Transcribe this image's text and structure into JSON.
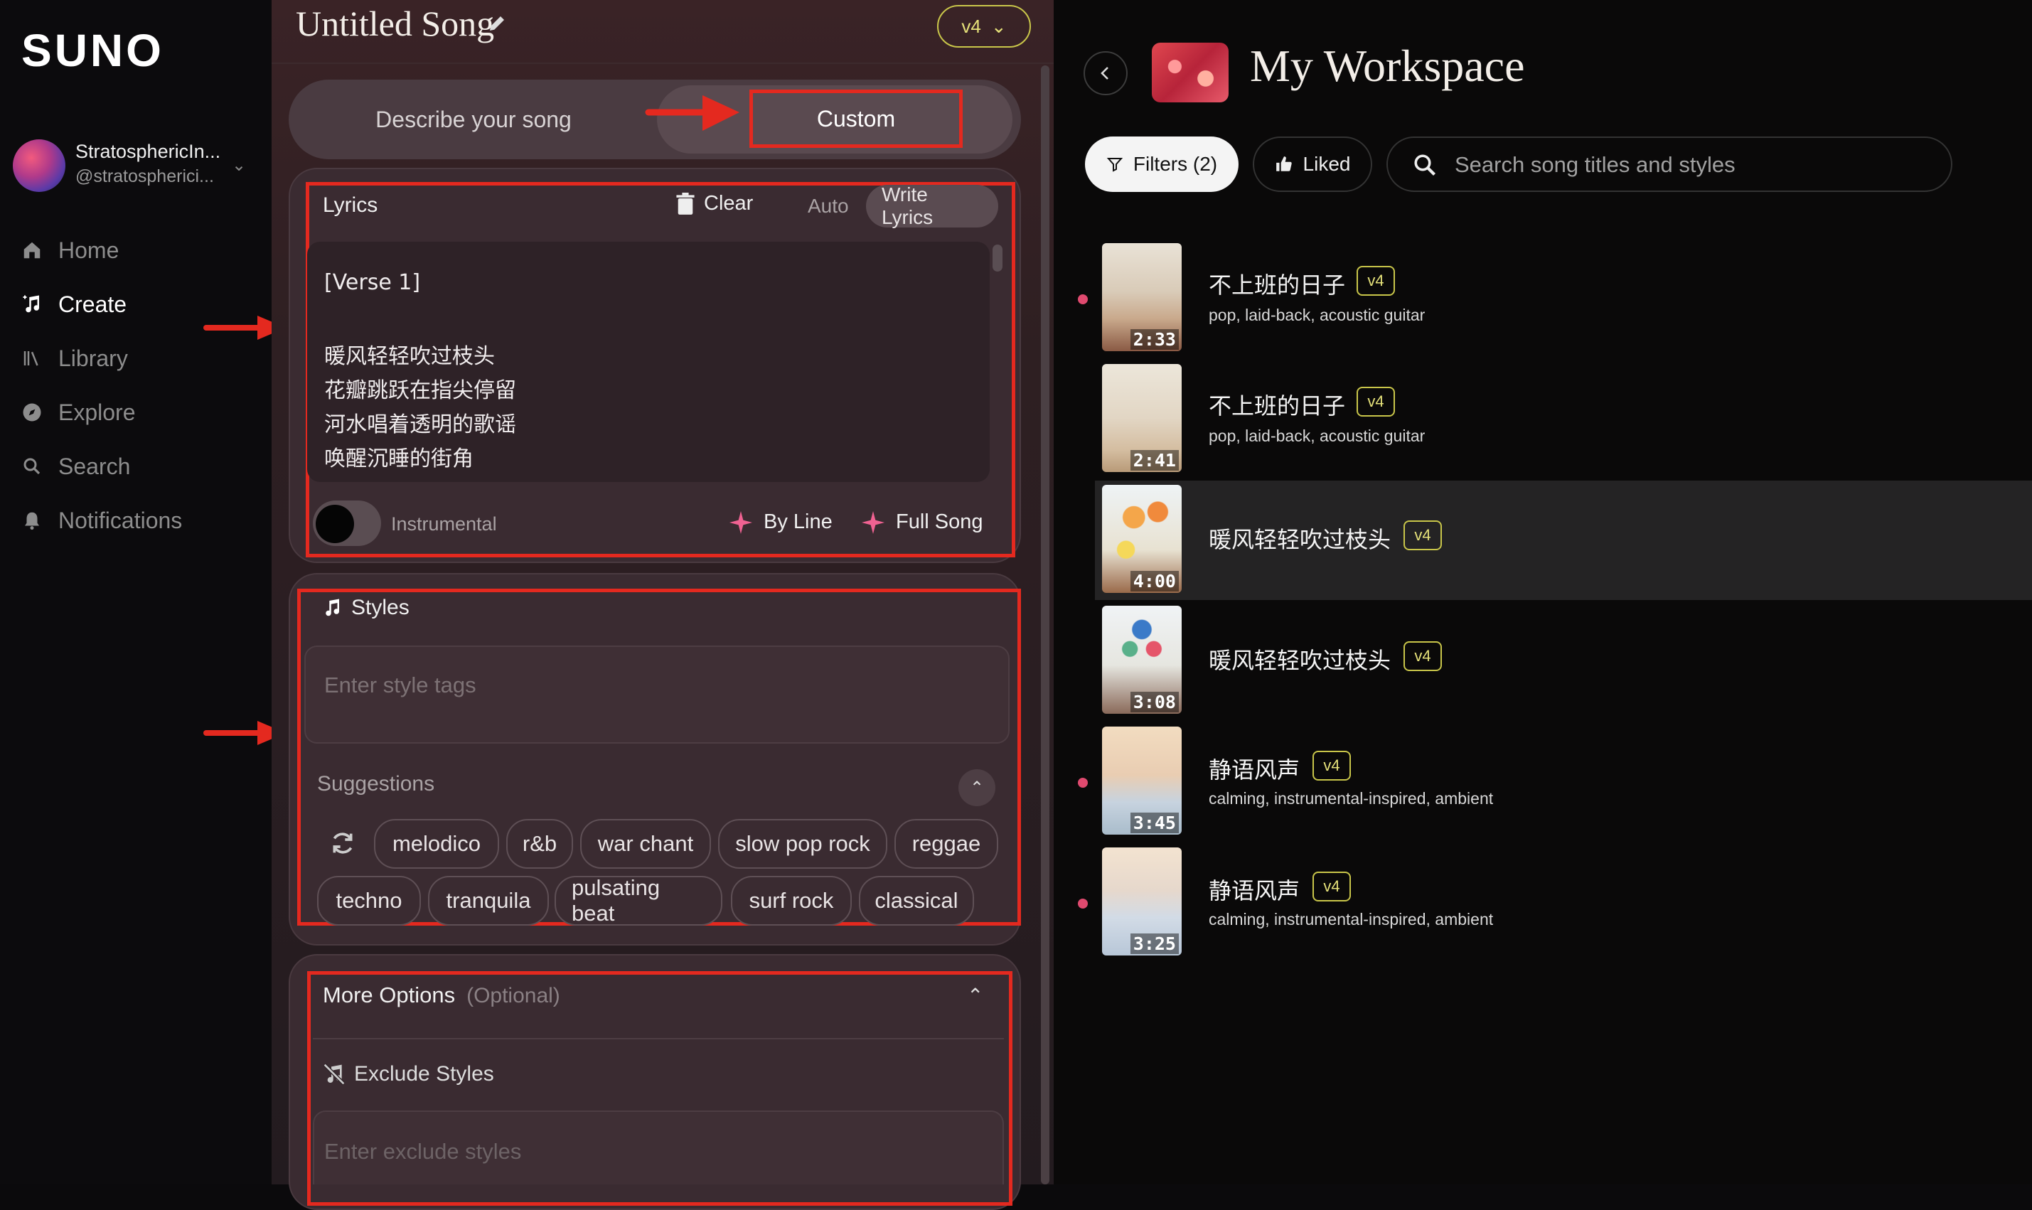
{
  "sidebar": {
    "logo": "SUNO",
    "account_name": "StratosphericIn...",
    "account_handle": "@stratospherici...",
    "nav": [
      {
        "label": "Home",
        "icon": "home-icon"
      },
      {
        "label": "Create",
        "icon": "music-note-icon"
      },
      {
        "label": "Library",
        "icon": "library-icon"
      },
      {
        "label": "Explore",
        "icon": "compass-icon"
      },
      {
        "label": "Search",
        "icon": "search-icon"
      },
      {
        "label": "Notifications",
        "icon": "bell-icon"
      }
    ],
    "active": "Create"
  },
  "create": {
    "title": "Untitled Song",
    "version": "v4",
    "mode_describe": "Describe your song",
    "mode_custom": "Custom",
    "lyrics": {
      "label": "Lyrics",
      "clear": "Clear",
      "auto": "Auto",
      "write": "Write Lyrics",
      "lines": [
        "[Verse 1]",
        "",
        "暖风轻轻吹过枝头",
        "花瓣跳跃在指尖停留",
        "河水唱着透明的歌谣",
        "唤醒沉睡的街角"
      ],
      "instrumental": "Instrumental",
      "by_line": "By Line",
      "full_song": "Full Song"
    },
    "styles": {
      "label": "Styles",
      "placeholder": "Enter style tags",
      "suggestions_label": "Suggestions",
      "tags_row1": [
        "melodico",
        "r&b",
        "war chant",
        "slow pop rock",
        "reggae"
      ],
      "tags_row2": [
        "techno",
        "tranquila",
        "pulsating beat",
        "surf rock",
        "classical"
      ]
    },
    "more_options": {
      "label": "More Options",
      "optional": "(Optional)",
      "exclude_label": "Exclude Styles",
      "exclude_placeholder": "Enter exclude styles"
    }
  },
  "workspace": {
    "title": "My Workspace",
    "filters": "Filters (2)",
    "liked": "Liked",
    "search_placeholder": "Search song titles and styles",
    "songs": [
      {
        "title": "不上班的日子",
        "badge": "v4",
        "tags": "pop, laid-back, acoustic guitar",
        "duration": "2:33",
        "dot": true
      },
      {
        "title": "不上班的日子",
        "badge": "v4",
        "tags": "pop, laid-back, acoustic guitar",
        "duration": "2:41",
        "dot": false
      },
      {
        "title": "暖风轻轻吹过枝头",
        "badge": "v4",
        "tags": "",
        "duration": "4:00",
        "dot": false,
        "selected": true
      },
      {
        "title": "暖风轻轻吹过枝头",
        "badge": "v4",
        "tags": "",
        "duration": "3:08",
        "dot": false
      },
      {
        "title": "静语风声",
        "badge": "v4",
        "tags": "calming, instrumental-inspired, ambient",
        "duration": "3:45",
        "dot": true
      },
      {
        "title": "静语风声",
        "badge": "v4",
        "tags": "calming, instrumental-inspired, ambient",
        "duration": "3:25",
        "dot": true
      }
    ]
  },
  "colors": {
    "accent_red": "#e4291f",
    "badge_yellow": "#c9c64a",
    "pink_sparkle": "#f06292"
  }
}
